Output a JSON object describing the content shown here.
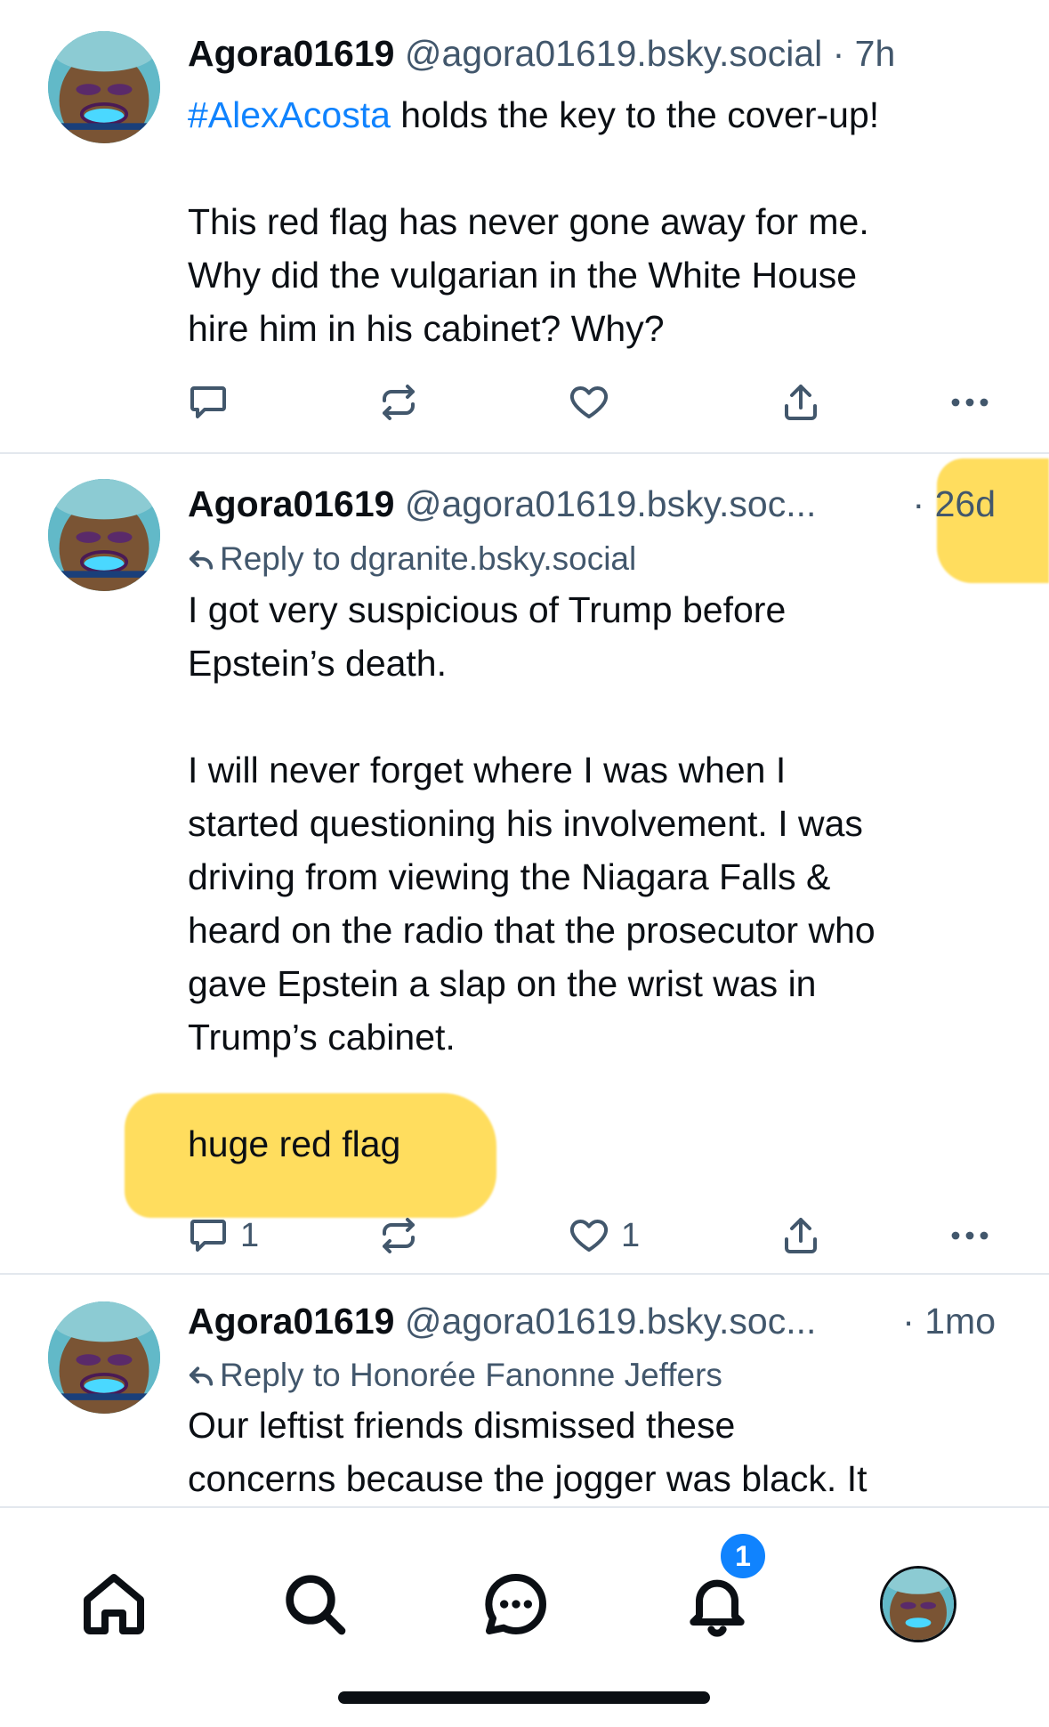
{
  "posts": [
    {
      "author": "Agora01619",
      "handle": "@agora01619.bsky.social",
      "time": "· 7h",
      "hashtag": "#AlexAcosta",
      "text_after_tag": " holds the key to the cover-up!",
      "body": "This red flag has never gone away for me.\nWhy did the vulgarian in the White House\nhire him in his cabinet? Why?",
      "reply_count": "",
      "like_count": ""
    },
    {
      "author": "Agora01619",
      "handle": "@agora01619.bsky.soc...",
      "time": "· 26d",
      "reply_to": "Reply to dgranite.bsky.social",
      "body": "I got very suspicious of Trump before\nEpstein’s death.\n\nI will never forget where I was when I\nstarted questioning his involvement. I was\ndriving from viewing the Niagara Falls &\nheard on the radio that the prosecutor who\ngave Epstein a slap on the wrist was in\nTrump’s cabinet.\n\nhuge red flag",
      "reply_count": "1",
      "like_count": "1"
    },
    {
      "author": "Agora01619",
      "handle": "@agora01619.bsky.soc...",
      "time": "· 1mo",
      "reply_to": "Reply to Honorée Fanonne Jeffers",
      "body": "Our leftist friends dismissed these\nconcerns because the jogger was black. It"
    }
  ],
  "tabbar": {
    "items": [
      "home-icon",
      "search-icon",
      "chat-icon",
      "bell-icon",
      "profile-avatar"
    ],
    "notification_badge": "1"
  },
  "colors": {
    "accent": "#1083fe",
    "muted": "#42576c",
    "highlight": "#ffd228",
    "divider": "#e3e8ee"
  }
}
